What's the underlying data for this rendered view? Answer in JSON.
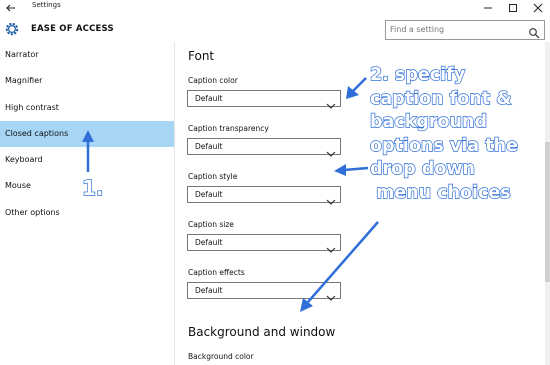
{
  "window": {
    "app_title": "Settings",
    "icons": {
      "back": "back-arrow-icon",
      "minimize": "minimize-icon",
      "maximize": "maximize-icon",
      "close": "close-icon"
    }
  },
  "header": {
    "title": "EASE OF ACCESS",
    "icon": "gear-icon"
  },
  "search": {
    "placeholder": "Find a setting",
    "icon": "search-icon"
  },
  "sidebar": {
    "items": [
      {
        "label": "Narrator",
        "selected": false
      },
      {
        "label": "Magnifier",
        "selected": false
      },
      {
        "label": "High contrast",
        "selected": false
      },
      {
        "label": "Closed captions",
        "selected": true
      },
      {
        "label": "Keyboard",
        "selected": false
      },
      {
        "label": "Mouse",
        "selected": false
      },
      {
        "label": "Other options",
        "selected": false
      }
    ],
    "selected_color": "#a6d5f5"
  },
  "main": {
    "font_section_title": "Font",
    "fields": [
      {
        "label": "Caption color",
        "value": "Default"
      },
      {
        "label": "Caption transparency",
        "value": "Default"
      },
      {
        "label": "Caption style",
        "value": "Default"
      },
      {
        "label": "Caption size",
        "value": "Default"
      },
      {
        "label": "Caption effects",
        "value": "Default"
      }
    ],
    "background_section_title": "Background and window",
    "background_fields": [
      {
        "label": "Background color"
      }
    ]
  },
  "annotations": {
    "step1": "1.",
    "step2": "2. specify\ncaption font &\nbackground\noptions via the\ndrop down\n menu choices",
    "color": "#2e6fd8"
  }
}
